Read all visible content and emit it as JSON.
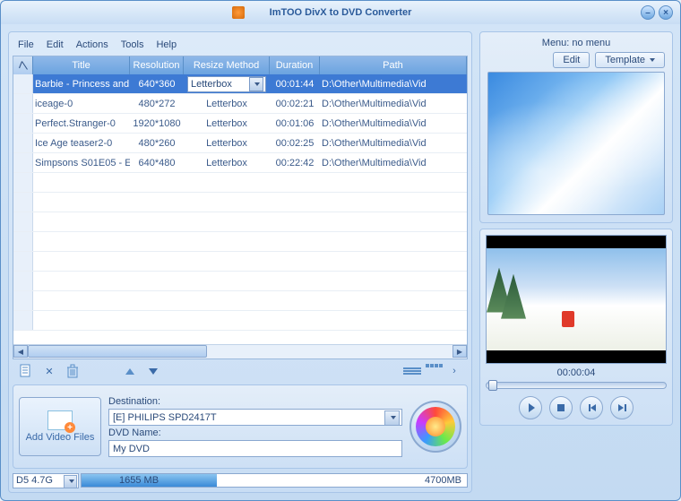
{
  "window": {
    "title": "ImTOO DivX to DVD Converter"
  },
  "menubar": [
    "File",
    "Edit",
    "Actions",
    "Tools",
    "Help"
  ],
  "table": {
    "headers": {
      "title": "Title",
      "resolution": "Resolution",
      "resize": "Resize Method",
      "duration": "Duration",
      "path": "Path"
    },
    "rows": [
      {
        "title": "Barbie - Princess and",
        "resolution": "640*360",
        "resize": "Letterbox",
        "duration": "00:01:44",
        "path": "D:\\Other\\Multimedia\\Vid",
        "selected": true
      },
      {
        "title": "iceage-0",
        "resolution": "480*272",
        "resize": "Letterbox",
        "duration": "00:02:21",
        "path": "D:\\Other\\Multimedia\\Vid",
        "selected": false
      },
      {
        "title": "Perfect.Stranger-0",
        "resolution": "1920*1080",
        "resize": "Letterbox",
        "duration": "00:01:06",
        "path": "D:\\Other\\Multimedia\\Vid",
        "selected": false
      },
      {
        "title": "Ice Age teaser2-0",
        "resolution": "480*260",
        "resize": "Letterbox",
        "duration": "00:02:25",
        "path": "D:\\Other\\Multimedia\\Vid",
        "selected": false
      },
      {
        "title": "Simpsons S01E05 - E",
        "resolution": "640*480",
        "resize": "Letterbox",
        "duration": "00:22:42",
        "path": "D:\\Other\\Multimedia\\Vid",
        "selected": false
      }
    ]
  },
  "bottom": {
    "add_label": "Add Video Files",
    "dest_label": "Destination:",
    "dest_value": "[E] PHILIPS SPD2417T",
    "dvd_label": "DVD Name:",
    "dvd_value": "My DVD"
  },
  "progress": {
    "disk_type": "D5   4.7G",
    "used": "1655 MB",
    "total": "4700MB"
  },
  "menu_panel": {
    "label": "Menu:  no menu",
    "edit": "Edit",
    "template": "Template"
  },
  "player": {
    "time": "00:00:04"
  }
}
